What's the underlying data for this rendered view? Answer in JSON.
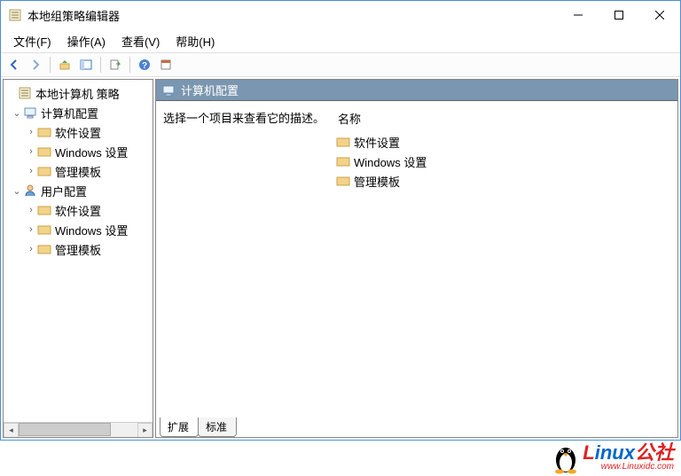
{
  "title": "本地组策略编辑器",
  "menus": {
    "file": "文件(F)",
    "action": "操作(A)",
    "view": "查看(V)",
    "help": "帮助(H)"
  },
  "tree": {
    "root": "本地计算机 策略",
    "computer": "计算机配置",
    "computer_children": {
      "soft": "软件设置",
      "win": "Windows 设置",
      "admin": "管理模板"
    },
    "user": "用户配置",
    "user_children": {
      "soft": "软件设置",
      "win": "Windows 设置",
      "admin": "管理模板"
    }
  },
  "detail": {
    "heading": "计算机配置",
    "description": "选择一个项目来查看它的描述。",
    "name_header": "名称",
    "items": {
      "soft": "软件设置",
      "win": "Windows 设置",
      "admin": "管理模板"
    }
  },
  "tabs": {
    "extended": "扩展",
    "standard": "标准"
  },
  "watermark": {
    "brand1": "L",
    "brand2": "inux",
    "suffix": "公社",
    "url": "www.Linuxidc.com"
  }
}
